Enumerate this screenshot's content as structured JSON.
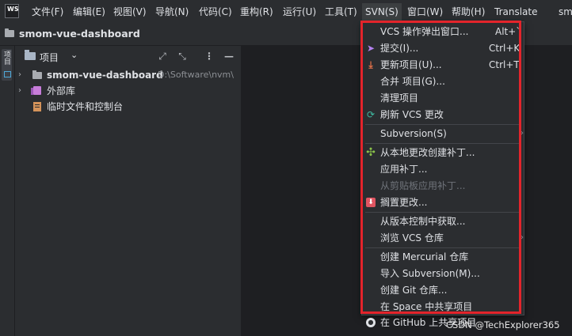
{
  "menubar": {
    "logo": "WS",
    "items": [
      "文件(F)",
      "编辑(E)",
      "视图(V)",
      "导航(N)",
      "代码(C)",
      "重构(R)",
      "运行(U)",
      "工具(T)",
      "SVN(S)",
      "窗口(W)",
      "帮助(H)",
      "Translate",
      "sm"
    ],
    "active_index": 8
  },
  "titlebar": {
    "project": "smom-vue-dashboard"
  },
  "side_strip": {
    "tab_label": "项目"
  },
  "project_panel": {
    "title": "项目",
    "buttons": {
      "expand": "⤢",
      "collapse": "⤡",
      "more": "⋮",
      "hide": "—"
    },
    "tree": [
      {
        "label": "smom-vue-dashboard",
        "path": "D:\\Software\\nvm\\"
      },
      {
        "label": "外部库"
      },
      {
        "label": "临时文件和控制台"
      }
    ]
  },
  "svn_menu": {
    "items": [
      {
        "label": "VCS 操作弹出窗口...",
        "shortcut": "Alt+`"
      },
      {
        "label": "提交(I)...",
        "shortcut": "Ctrl+K",
        "icon": "commit-arrow-icon"
      },
      {
        "label": "更新项目(U)...",
        "shortcut": "Ctrl+T",
        "icon": "update-arrow-icon"
      },
      {
        "label": "合并 项目(G)..."
      },
      {
        "label": "清理项目"
      },
      {
        "label": "刷新 VCS 更改",
        "icon": "refresh-icon"
      },
      {
        "label": "Subversion(S)",
        "submenu": "›"
      },
      {
        "label": "从本地更改创建补丁...",
        "icon": "patch-icon"
      },
      {
        "label": "应用补丁..."
      },
      {
        "label": "从剪贴板应用补丁...",
        "disabled": true
      },
      {
        "label": "搁置更改...",
        "icon": "shelve-icon"
      },
      {
        "label": "从版本控制中获取..."
      },
      {
        "label": "浏览 VCS 仓库",
        "submenu": "›"
      },
      {
        "label": "创建 Mercurial 仓库"
      },
      {
        "label": "导入 Subversion(M)..."
      },
      {
        "label": "创建 Git 仓库..."
      },
      {
        "label": "在 Space 中共享项目"
      },
      {
        "label": "在 GitHub 上共享项目",
        "icon": "github-icon"
      }
    ],
    "highlight_color": "#e3242b"
  },
  "watermark": "CSDN @TechExplorer365"
}
